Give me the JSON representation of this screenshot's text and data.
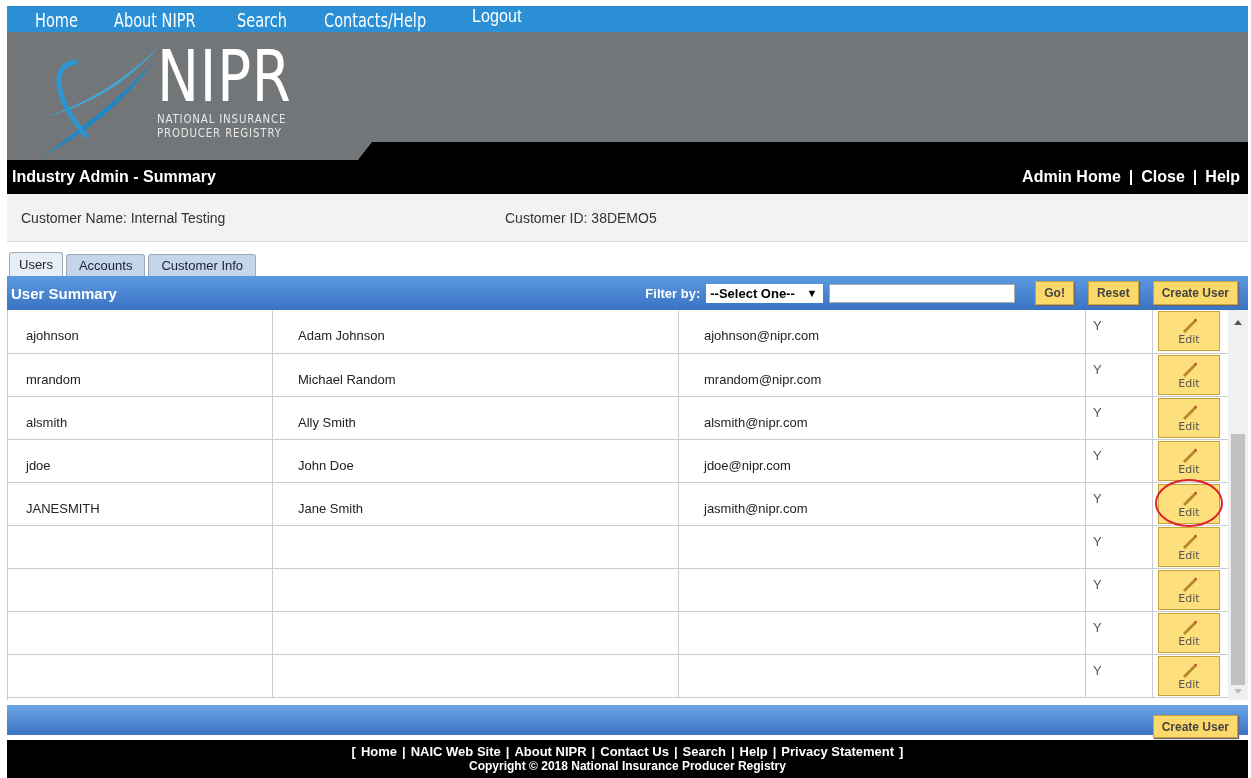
{
  "top_nav": [
    "Home",
    "About NIPR",
    "Search",
    "Contacts/Help",
    "Logout"
  ],
  "logo": {
    "name": "NIPR",
    "tagline_1": "NATIONAL INSURANCE",
    "tagline_2": "PRODUCER REGISTRY"
  },
  "title_bar": {
    "title": "Industry Admin - Summary",
    "links": [
      "Admin Home",
      "Close",
      "Help"
    ],
    "separator": "|"
  },
  "customer": {
    "name": "Customer Name: Internal Testing",
    "id": "Customer ID: 38DEMO5"
  },
  "tabs": [
    {
      "label": "Users",
      "selected": true
    },
    {
      "label": "Accounts",
      "selected": false
    },
    {
      "label": "Customer Info",
      "selected": false
    }
  ],
  "panel": {
    "title": "User Summary",
    "filter_label": "Filter by:",
    "select_value": "--Select One--",
    "caret": "▼",
    "buttons": [
      "Go!",
      "Reset",
      "Create User"
    ]
  },
  "rows": [
    {
      "user": "ajohnson",
      "name": "Adam Johnson",
      "email": "ajohnson@nipr.com",
      "flag": "Y",
      "action": "Edit",
      "circled": false
    },
    {
      "user": "mrandom",
      "name": "Michael Random",
      "email": "mrandom@nipr.com",
      "flag": "Y",
      "action": "Edit",
      "circled": false
    },
    {
      "user": "alsmith",
      "name": "Ally Smith",
      "email": "alsmith@nipr.com",
      "flag": "Y",
      "action": "Edit",
      "circled": false
    },
    {
      "user": "jdoe",
      "name": "John Doe",
      "email": "jdoe@nipr.com",
      "flag": "Y",
      "action": "Edit",
      "circled": false
    },
    {
      "user": "JANESMITH",
      "name": "Jane Smith",
      "email": "jasmith@nipr.com",
      "flag": "Y",
      "action": "Edit",
      "circled": true
    },
    {
      "user": "",
      "name": "",
      "email": "",
      "flag": "Y",
      "action": "Edit",
      "circled": false
    },
    {
      "user": "",
      "name": "",
      "email": "",
      "flag": "Y",
      "action": "Edit",
      "circled": false
    },
    {
      "user": "",
      "name": "",
      "email": "",
      "flag": "Y",
      "action": "Edit",
      "circled": false
    },
    {
      "user": "",
      "name": "",
      "email": "",
      "flag": "Y",
      "action": "Edit",
      "circled": false
    }
  ],
  "bottom_button": "Create User",
  "footer": {
    "open": "[",
    "close": "]",
    "separator": "|",
    "links": [
      "Home",
      "NAIC Web Site",
      "About NIPR",
      "Contact Us",
      "Search",
      "Help",
      "Privacy Statement"
    ],
    "copyright": "Copyright © 2018 National Insurance Producer Registry"
  }
}
